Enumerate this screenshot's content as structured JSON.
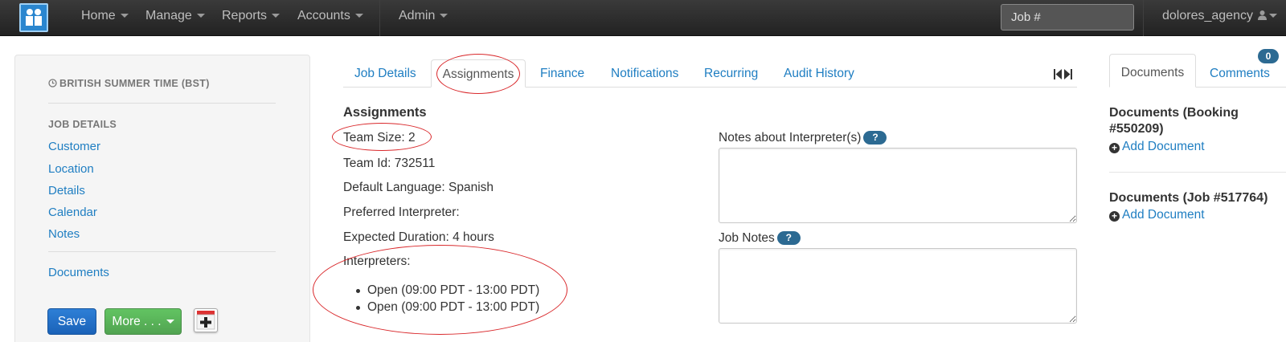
{
  "navbar": {
    "menu": [
      {
        "label": "Home"
      },
      {
        "label": "Manage"
      },
      {
        "label": "Reports"
      },
      {
        "label": "Accounts"
      },
      {
        "label": "Admin"
      }
    ],
    "job_search_placeholder": "Job #",
    "user": "dolores_agency"
  },
  "sidebar": {
    "timezone": "BRITISH SUMMER TIME (BST)",
    "section_heading": "JOB DETAILS",
    "links": [
      "Customer",
      "Location",
      "Details",
      "Calendar",
      "Notes"
    ],
    "documents_link": "Documents",
    "save_label": "Save",
    "more_label": "More . . ."
  },
  "tabs": [
    "Job Details",
    "Assignments",
    "Finance",
    "Notifications",
    "Recurring",
    "Audit History"
  ],
  "active_tab": "Assignments",
  "assignments": {
    "heading": "Assignments",
    "team_size": "Team Size: 2",
    "team_id": "Team Id: 732511",
    "default_language": "Default Language: Spanish",
    "preferred_interpreter": "Preferred Interpreter:",
    "expected_duration": "Expected Duration: 4 hours",
    "interpreters_label": "Interpreters:",
    "interpreters": [
      "Open (09:00 PDT - 13:00 PDT)",
      "Open (09:00 PDT - 13:00 PDT)"
    ],
    "notes_interpreter_label": "Notes about Interpreter(s)",
    "job_notes_label": "Job Notes",
    "help_glyph": "?"
  },
  "right_panel": {
    "tabs": [
      "Documents",
      "Comments"
    ],
    "comments_count": "0",
    "booking_docs_heading": "Documents (Booking #550209)",
    "job_docs_heading": "Documents (Job #517764)",
    "add_document_label": "Add Document"
  },
  "colors": {
    "navbar": "#222222",
    "link": "#1f7ec2",
    "save_button": "#1a62b8",
    "more_button": "#51a351",
    "badge": "#2c6a92",
    "annotation": "#d9282b"
  }
}
